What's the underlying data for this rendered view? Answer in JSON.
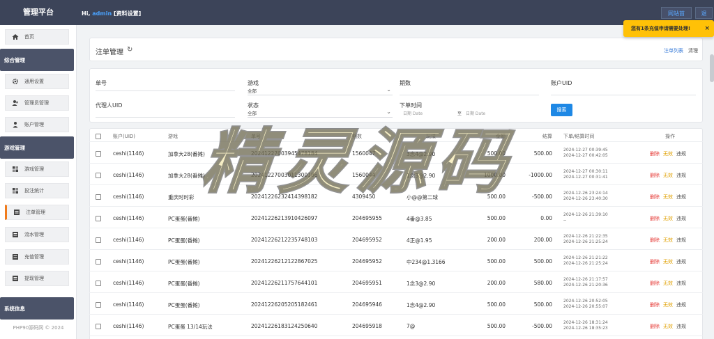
{
  "brand": "管理平台",
  "header": {
    "greeting": "Hi,",
    "user": "admin",
    "profile_link": "[资料设置]",
    "home_button": "网站首页",
    "exit_button": "退出"
  },
  "notice": {
    "text": "您有1条充值申请需要处理!",
    "close": "×"
  },
  "sidebar": {
    "home": "首页",
    "section_general": "综合管理",
    "general_items": [
      "通用设置",
      "管理员管理",
      "账户管理"
    ],
    "section_game": "游戏管理",
    "game_items": [
      "游戏管理",
      "投注统计",
      "注单管理",
      "流水管理",
      "充值管理",
      "提现管理"
    ],
    "active_item": "注单管理",
    "section_system": "系统信息",
    "footer": "PHP90源码网 © 2024"
  },
  "page": {
    "title": "注单管理",
    "refresh_icon": "↻",
    "crumb_list": "注单列表",
    "crumb_clear": "清理"
  },
  "filters": {
    "order_no_label": "单号",
    "game_label": "游戏",
    "game_value": "全部",
    "period_label": "期数",
    "account_uid_label": "账户UID",
    "agent_uid_label": "代理人UID",
    "status_label": "状态",
    "status_value": "全部",
    "time_label": "下单时间",
    "date_from_placeholder": "日期 Date",
    "date_to_label": "至",
    "date_to_placeholder": "日期 Date",
    "search_button": "搜索"
  },
  "table": {
    "headers": [
      "账户(UID)",
      "游戏",
      "单号",
      "期数",
      "玩法",
      "金额",
      "结算",
      "下单/结算时间",
      "操作"
    ],
    "action_delete": "删除",
    "action_invalid": "无效",
    "action_violation": "违规",
    "rows": [
      {
        "account": "ceshi(1146)",
        "game": "加拿大28(番摊)",
        "order": "20241227003945478184",
        "period": "1560047",
        "play": "3念4@2.90",
        "amount": "500.00",
        "settle": "500.00",
        "t1": "2024-12-27 00:39:45",
        "t2": "2024-12-27 00:42:05"
      },
      {
        "account": "ceshi(1146)",
        "game": "加拿大28(番摊)",
        "order": "20241227003011300186",
        "period": "1560044",
        "play": "1念3@2.90",
        "amount": "1000.00",
        "settle": "-1000.00",
        "t1": "2024-12-27 00:30:11",
        "t2": "2024-12-27 00:31:41"
      },
      {
        "account": "ceshi(1146)",
        "game": "重庆时时彩",
        "order": "20241226232414398182",
        "period": "4309450",
        "play": "小@@第二球",
        "amount": "500.00",
        "settle": "-500.00",
        "t1": "2024-12-26 23:24:14",
        "t2": "2024-12-26 23:40:30"
      },
      {
        "account": "ceshi(1146)",
        "game": "PC蛋蛋(番摊)",
        "order": "20241226213910426097",
        "period": "204695955",
        "play": "4番@3.85",
        "amount": "500.00",
        "settle": "0.00",
        "t1": "2024-12-26 21:39:10",
        "t2": "--"
      },
      {
        "account": "ceshi(1146)",
        "game": "PC蛋蛋(番摊)",
        "order": "20241226212235748103",
        "period": "204695952",
        "play": "4正@1.95",
        "amount": "200.00",
        "settle": "200.00",
        "t1": "2024-12-26 21:22:35",
        "t2": "2024-12-26 21:25:24"
      },
      {
        "account": "ceshi(1146)",
        "game": "PC蛋蛋(番摊)",
        "order": "20241226212122867025",
        "period": "204695952",
        "play": "中234@1.3166",
        "amount": "500.00",
        "settle": "500.00",
        "t1": "2024-12-26 21:21:22",
        "t2": "2024-12-26 21:25:24"
      },
      {
        "account": "ceshi(1146)",
        "game": "PC蛋蛋(番摊)",
        "order": "20241226211757644101",
        "period": "204695951",
        "play": "1念3@2.90",
        "amount": "200.00",
        "settle": "580.00",
        "t1": "2024-12-26 21:17:57",
        "t2": "2024-12-26 21:20:36"
      },
      {
        "account": "ceshi(1146)",
        "game": "PC蛋蛋(番摊)",
        "order": "20241226205205182461",
        "period": "204695946",
        "play": "1念4@2.90",
        "amount": "500.00",
        "settle": "500.00",
        "t1": "2024-12-26 20:52:05",
        "t2": "2024-12-26 20:55:07"
      },
      {
        "account": "ceshi(1146)",
        "game": "PC蛋蛋 13/14玩法",
        "order": "20241226183124250640",
        "period": "204695918",
        "play": "7@",
        "amount": "500.00",
        "settle": "-500.00",
        "t1": "2024-12-26 18:31:24",
        "t2": "2024-12-26 18:35:23"
      }
    ]
  },
  "watermark": "精灵源码"
}
